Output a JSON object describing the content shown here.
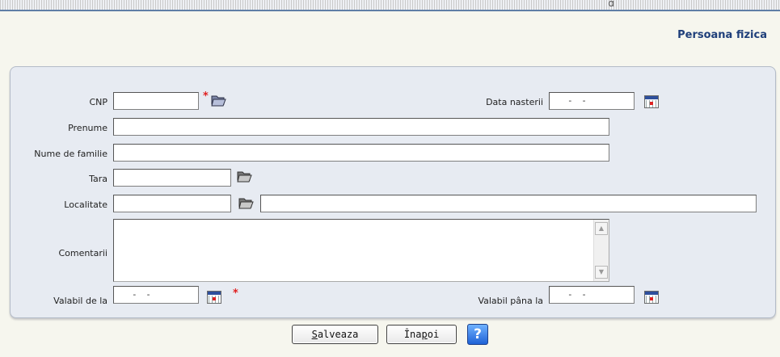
{
  "header": {
    "cut_text": "g",
    "title": "Persoana fizica"
  },
  "form": {
    "cnp": {
      "label": "CNP",
      "value": "",
      "required_mark": "*"
    },
    "birth_date": {
      "label": "Data nasterii",
      "value": "- -"
    },
    "first_name": {
      "label": "Prenume",
      "value": ""
    },
    "last_name": {
      "label": "Nume de familie",
      "value": ""
    },
    "country": {
      "label": "Tara",
      "value": ""
    },
    "locality": {
      "label": "Localitate",
      "value": "",
      "detail_value": ""
    },
    "comments": {
      "label": "Comentarii",
      "value": ""
    },
    "valid_from": {
      "label": "Valabil de la",
      "value": "- -",
      "required_mark": "*"
    },
    "valid_to": {
      "label": "Valabil pâna la",
      "value": "- -"
    }
  },
  "actions": {
    "save": {
      "hotkey": "S",
      "rest": "alveaza"
    },
    "back": {
      "pre": "Îna",
      "hotkey": "p",
      "post": "oi"
    },
    "help_label": "?"
  },
  "icons": {
    "lookup": "folder-search-icon",
    "calendar": "calendar-icon",
    "help": "help-icon"
  },
  "colors": {
    "title": "#1f3f7a",
    "panel": "#e7ebf2",
    "required": "#e02020",
    "accent": "#2e4f9c"
  }
}
